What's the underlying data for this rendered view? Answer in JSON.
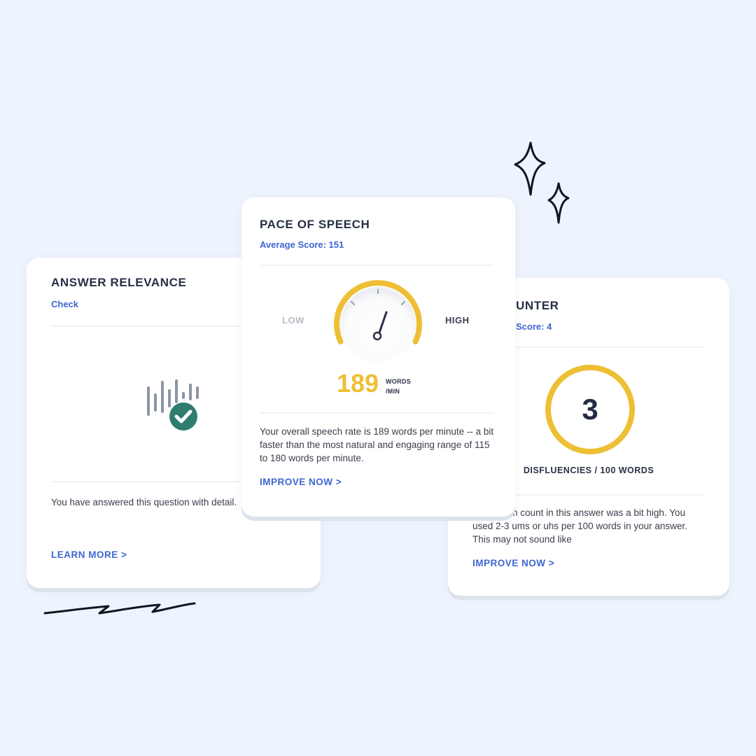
{
  "relevance": {
    "title": "ANSWER RELEVANCE",
    "subtitle": "Check",
    "body": "You have answered this question with detail.",
    "cta": "LEARN MORE >",
    "icon": "soundwave-check-icon",
    "check_color": "#2e7d6f"
  },
  "pace": {
    "title": "PACE OF SPEECH",
    "subtitle": "Average Score: 151",
    "low_label": "LOW",
    "high_label": "HIGH",
    "value": "189",
    "unit_line1": "WORDS",
    "unit_line2": "/MIN",
    "body": "Your overall speech rate is 189 words per minute -- a bit faster than the most natural and engaging range of 115 to 180 words per minute.",
    "cta": "IMPROVE NOW >",
    "gauge_color": "#eebf34"
  },
  "disfluency": {
    "title": "UNTER",
    "subtitle": "Score: 4",
    "value": "3",
    "label": "DISFLUENCIES / 100 WORDS",
    "body": "n! Your um count in this answer was a bit high. You used 2-3 ums or uhs per 100 words in your answer. This may not sound like",
    "cta": "IMPROVE NOW >",
    "ring_color": "#eebf34"
  },
  "colors": {
    "background": "#eef4fe",
    "accent_blue": "#3e66d1",
    "accent_yellow": "#eebf34",
    "title_text": "#262f45"
  }
}
